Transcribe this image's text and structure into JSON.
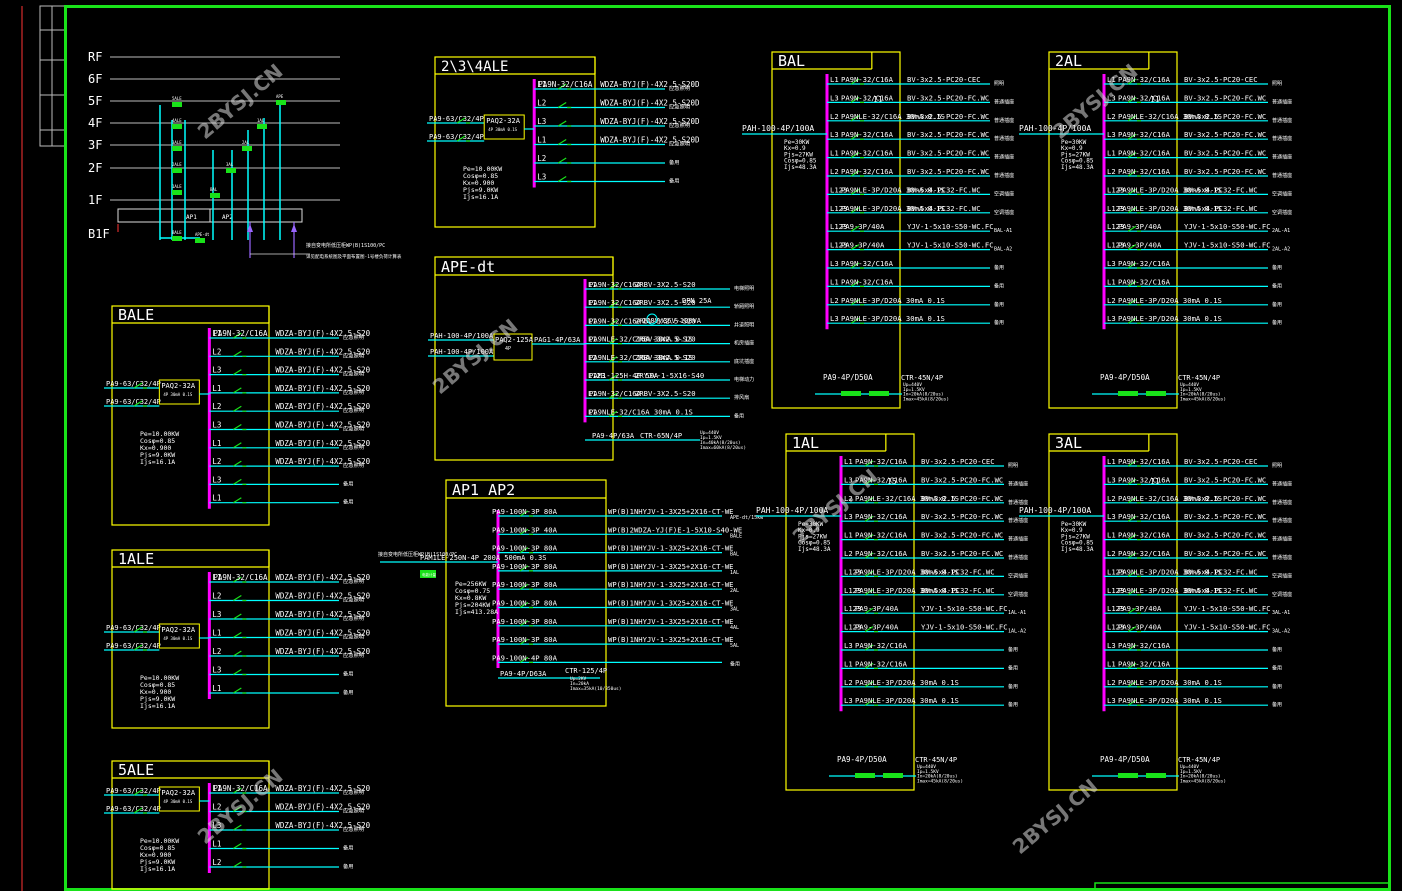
{
  "colors": {
    "frame": "#19e219",
    "panel": "#ffff00",
    "bus": "#ff00ff",
    "feeder": "#00ffff",
    "switch": "#19e219",
    "text": "#ffffff",
    "label": "#ffff66",
    "ext": "#ff3333"
  },
  "riser": {
    "floors": [
      "RF",
      "6F",
      "5F",
      "4F",
      "3F",
      "2F",
      "1F",
      "B1F"
    ],
    "box1": "AP1",
    "box2": "AP2",
    "note1": "接自变电所低压柜WP(B)1S100/PC",
    "note2": "详见配电系统图及平面布置图-1号楼负荷计算表",
    "tags": [
      "5ALE",
      "4ALE",
      "3ALE",
      "2ALE",
      "1ALE",
      "BALE",
      "3AL",
      "2AL",
      "1AL",
      "APE",
      "BAL",
      "APE-dt"
    ]
  },
  "watermarks": [
    "2BYSJ.CN",
    "2BYSJ.CN",
    "2BYSJ.CN",
    "2BYSJ.CN",
    "2BYSJ.CN",
    "2BYSJ.CN"
  ],
  "panels": {
    "ale234": {
      "title": "2\\3\\4ALE",
      "in1": "PA9-63/C32/4P",
      "in2": "PA9-63/C32/4P",
      "spd": "PAQ2-32A",
      "spd_sub": "4P 30mA 0.1S",
      "calc": [
        "Pe=10.00KW",
        "Cosφ=0.85",
        "Kx=0.900",
        "Pjs=9.0KW",
        "Ijs=16.1A"
      ],
      "rows": [
        {
          "ph": "L1",
          "cb": "PA9N-32/C16A",
          "cable": "WDZA-BYJ(F)-4X2.5-S20D",
          "use": "应急照明"
        },
        {
          "ph": "L2",
          "cb": "",
          "cable": "WDZA-BYJ(F)-4X2.5-S20D",
          "use": "应急照明"
        },
        {
          "ph": "L3",
          "cb": "",
          "cable": "WDZA-BYJ(F)-4X2.5-S20D",
          "use": "应急照明"
        },
        {
          "ph": "L1",
          "cb": "",
          "cable": "WDZA-BYJ(F)-4X2.5-S20D",
          "use": "应急照明"
        },
        {
          "ph": "L2",
          "cb": "",
          "cable": "",
          "use": "备用"
        },
        {
          "ph": "L3",
          "cb": "",
          "cable": "",
          "use": "备用"
        }
      ]
    },
    "bale": {
      "title": "BALE",
      "in1": "PA9-63/C32/4P",
      "in2": "PA9-63/C32/4P",
      "spd": "PAQ2-32A",
      "spd_sub": "4P 30mA 0.1S",
      "calc": [
        "Pe=10.00KW",
        "Cosφ=0.85",
        "Kx=0.900",
        "Pjs=9.0KW",
        "Ijs=16.1A"
      ],
      "rows": [
        {
          "ph": "L1",
          "cb": "PA9N-32/C16A",
          "cable": "WDZA-BYJ(F)-4X2.5-S20",
          "use": "应急照明"
        },
        {
          "ph": "L2",
          "cb": "",
          "cable": "WDZA-BYJ(F)-4X2.5-S20",
          "use": "应急照明"
        },
        {
          "ph": "L3",
          "cb": "",
          "cable": "WDZA-BYJ(F)-4X2.5-S20",
          "use": "应急照明"
        },
        {
          "ph": "L1",
          "cb": "",
          "cable": "WDZA-BYJ(F)-4X2.5-S20",
          "use": "应急照明"
        },
        {
          "ph": "L2",
          "cb": "",
          "cable": "WDZA-BYJ(F)-4X2.5-S20",
          "use": "应急照明"
        },
        {
          "ph": "L3",
          "cb": "",
          "cable": "WDZA-BYJ(F)-4X2.5-S20",
          "use": "应急照明"
        },
        {
          "ph": "L1",
          "cb": "",
          "cable": "WDZA-BYJ(F)-4X2.5-S20",
          "use": "应急照明"
        },
        {
          "ph": "L2",
          "cb": "",
          "cable": "WDZA-BYJ(F)-4X2.5-S20",
          "use": "应急照明"
        },
        {
          "ph": "L3",
          "cb": "",
          "cable": "",
          "use": "备用"
        },
        {
          "ph": "L1",
          "cb": "",
          "cable": "",
          "use": "备用"
        }
      ]
    },
    "ale1": {
      "title": "1ALE",
      "in1": "PA9-63/C32/4P",
      "in2": "PA9-63/C32/4P",
      "spd": "PAQ2-32A",
      "spd_sub": "4P 30mA 0.1S",
      "calc": [
        "Pe=10.00KW",
        "Cosφ=0.85",
        "Kx=0.900",
        "Pjs=9.0KW",
        "Ijs=16.1A"
      ],
      "rows": [
        {
          "ph": "L1",
          "cb": "PA9N-32/C16A",
          "cable": "WDZA-BYJ(F)-4X2.5-S20",
          "use": "应急照明"
        },
        {
          "ph": "L2",
          "cb": "",
          "cable": "WDZA-BYJ(F)-4X2.5-S20",
          "use": "应急照明"
        },
        {
          "ph": "L3",
          "cb": "",
          "cable": "WDZA-BYJ(F)-4X2.5-S20",
          "use": "应急照明"
        },
        {
          "ph": "L1",
          "cb": "",
          "cable": "WDZA-BYJ(F)-4X2.5-S20",
          "use": "应急照明"
        },
        {
          "ph": "L2",
          "cb": "",
          "cable": "WDZA-BYJ(F)-4X2.5-S20",
          "use": "应急照明"
        },
        {
          "ph": "L3",
          "cb": "",
          "cable": "",
          "use": "备用"
        },
        {
          "ph": "L1",
          "cb": "",
          "cable": "",
          "use": "备用"
        }
      ]
    },
    "ale5": {
      "title": "5ALE",
      "in1": "PA9-63/C32/4P",
      "in2": "PA9-63/C32/4P",
      "spd": "PAQ2-32A",
      "spd_sub": "4P 30mA 0.1S",
      "calc": [
        "Pe=10.00KW",
        "Cosφ=0.85",
        "Kx=0.900",
        "Pjs=9.0KW",
        "Ijs=16.1A"
      ],
      "rows": [
        {
          "ph": "L1",
          "cb": "PA9N-32/C16A",
          "cable": "WDZA-BYJ(F)-4X2.5-S20",
          "use": "应急照明"
        },
        {
          "ph": "L2",
          "cb": "",
          "cable": "WDZA-BYJ(F)-4X2.5-S20",
          "use": "应急照明"
        },
        {
          "ph": "L3",
          "cb": "",
          "cable": "WDZA-BYJ(F)-4X2.5-S20",
          "use": "应急照明"
        },
        {
          "ph": "L1",
          "cb": "",
          "cable": "",
          "use": "备用"
        },
        {
          "ph": "L2",
          "cb": "",
          "cable": "",
          "use": "备用"
        }
      ]
    },
    "apedt": {
      "title": "APE-dt",
      "in1": "PAH-100-4P/100A",
      "in2": "PAH-100-4P/100A",
      "ats": "PAQ2-125A",
      "ats_sub": "4P",
      "main": "PAG1-4P/63A",
      "rows": [
        {
          "ph": "L1",
          "cb": "PA9N-32/C16A",
          "cable": "ZRBV-3X2.5-S20",
          "use": "电梯照明"
        },
        {
          "ph": "L1",
          "cb": "PA9N-32/C16A",
          "cable": "ZRBV-3X2.5-S20",
          "use": "轿厢照明"
        },
        {
          "ph": "L1",
          "cb": "PA9N-32/C16A",
          "cable": "ZRBV-3X2.5-S20",
          "use": "井道照明"
        },
        {
          "ph": "L1",
          "cb": "PA9NLE-32/C16A 30mA 0.1S",
          "cable": "ZRBV-3X2.5-S20",
          "use": "机房插座"
        },
        {
          "ph": "L2",
          "cb": "PA9NLE-32/C16A 30mA 0.1S",
          "cable": "ZRBV-3X2.5-S20",
          "use": "底坑插座"
        },
        {
          "ph": "L123",
          "cb": "PAM1-125H-4P 50A",
          "cable": "ZRYJV-1-5X16-S40",
          "use": "电梯动力"
        },
        {
          "ph": "L1",
          "cb": "PA9N-32/C16A",
          "cable": "ZRBV-3X2.5-S20",
          "use": "排风扇"
        },
        {
          "ph": "L1",
          "cb": "PA9NLE-32/C16A 30mA 0.1S",
          "cable": "",
          "use": "备用"
        }
      ],
      "extra": [
        "DPN 25A",
        "220V/36V-100VA"
      ],
      "spd": "PA9-4P/63A",
      "ctr": "CTR-65N/4P",
      "ctr_sub": [
        "Up=440V",
        "Ip=1.5KV",
        "In=40kA(8/20us)",
        "Imax=60kA(8/20us)"
      ]
    },
    "ap12": {
      "title": "AP1 AP2",
      "in_note": "接自变电所低压柜WP(B)1S100/PC",
      "in_cb": "PAM1LE-250N-4P 200A 500mA 0.3S",
      "meter": "电能计量",
      "calc": [
        "Pe=256KW",
        "Cosφ=0.75",
        "Kx=0.8KW",
        "Pjs=204KW",
        "Ijs=413.28A"
      ],
      "rows": [
        {
          "cb": "PA9-100N-3P 80A",
          "cable": "WP(B)1NHYJV-1-3X25+2X16-CT-WE",
          "to": "APE-dt/15kw"
        },
        {
          "cb": "PA9-100N-3P 40A",
          "cable": "WP(B)2WDZA-YJ(F)E-1-5X10-S40-WE",
          "to": "BALE"
        },
        {
          "cb": "PA9-100N-3P 80A",
          "cable": "WP(B)1NHYJV-1-3X25+2X16-CT-WE",
          "to": "BAL"
        },
        {
          "cb": "PA9-100N-3P 80A",
          "cable": "WP(B)1NHYJV-1-3X25+2X16-CT-WE",
          "to": "1AL"
        },
        {
          "cb": "PA9-100N-3P 80A",
          "cable": "WP(B)1NHYJV-1-3X25+2X16-CT-WE",
          "to": "2AL"
        },
        {
          "cb": "PA9-100N-3P 80A",
          "cable": "WP(B)1NHYJV-1-3X25+2X16-CT-WE",
          "to": "3AL"
        },
        {
          "cb": "PA9-100N-3P 80A",
          "cable": "WP(B)1NHYJV-1-3X25+2X16-CT-WE",
          "to": "4AL"
        },
        {
          "cb": "PA9-100N-3P 80A",
          "cable": "WP(B)1NHYJV-1-3X25+2X16-CT-WE",
          "to": "5AL"
        },
        {
          "cb": "PA9-100N-4P 80A",
          "cable": "",
          "to": "备用"
        }
      ],
      "spd": "PA9-4P/D63A",
      "ctr": "CTR-125/4P",
      "ctr_sub": [
        "Up=2KV",
        "In=20kA",
        "Imax=35kA(10/350us)"
      ]
    },
    "bal": {
      "title": "BAL",
      "in1": "PAH-100-4P/100A",
      "calc": [
        "Pe=30KW",
        "Kx=0.9",
        "Pjs=27KW",
        "Cosφ=0.85",
        "Ijs=48.3A"
      ],
      "mark": "11",
      "rows": [
        {
          "ph": "L1",
          "cb": "PA9N-32/C16A",
          "cable": "BV-3x2.5-PC20-CEC",
          "use": "照明"
        },
        {
          "ph": "L3",
          "cb": "PA9N-32/C16A",
          "cable": "BV-3x2.5-PC20-FC.WC",
          "use": "普通插座"
        },
        {
          "ph": "L2",
          "cb": "PA9NLE-32/C16A 30mA 0.1S",
          "cable": "BV-3x2.5-PC20-FC.WC",
          "use": "普通插座"
        },
        {
          "ph": "L3",
          "cb": "PA9N-32/C16A",
          "cable": "BV-3x2.5-PC20-FC.WC",
          "use": "普通插座"
        },
        {
          "ph": "L1",
          "cb": "PA9N-32/C16A",
          "cable": "BV-3x2.5-PC20-FC.WC",
          "use": "普通插座"
        },
        {
          "ph": "L2",
          "cb": "PA9N-32/C16A",
          "cable": "BV-3x2.5-PC20-FC.WC",
          "use": "普通插座"
        },
        {
          "ph": "L123",
          "cb": "PA9NLE-3P/D20A 30mA 0.1S",
          "cable": "BV-5x4-PC32-FC.WC",
          "use": "空调插座"
        },
        {
          "ph": "L123",
          "cb": "PA9NLE-3P/D20A 30mA 0.1S",
          "cable": "BV-5x4-PC32-FC.WC",
          "use": "空调插座"
        },
        {
          "ph": "L123",
          "cb": "PA9-3P/40A",
          "cable": "YJV-1-5x10-S50-WC.FC",
          "use": "BAL-A1"
        },
        {
          "ph": "L123",
          "cb": "PA9-3P/40A",
          "cable": "YJV-1-5x10-S50-WC.FC",
          "use": "BAL-A2"
        },
        {
          "ph": "L3",
          "cb": "PA9N-32/C16A",
          "cable": "",
          "use": "备用"
        },
        {
          "ph": "L1",
          "cb": "PA9N-32/C16A",
          "cable": "",
          "use": "备用"
        },
        {
          "ph": "L2",
          "cb": "PA9NLE-3P/D20A 30mA 0.1S",
          "cable": "",
          "use": "备用"
        },
        {
          "ph": "L3",
          "cb": "PA9NLE-3P/D20A 30mA 0.1S",
          "cable": "",
          "use": "备用"
        }
      ],
      "spd": "PA9-4P/D50A",
      "ctr": "CTR-45N/4P",
      "ctr_sub": [
        "Up=440V",
        "Ip=1.5KV",
        "In=20kA(8/20us)",
        "Imax=45kA(8/20us)"
      ]
    },
    "al2": {
      "title": "2AL",
      "in1": "PAH-100-4P/100A",
      "calc": [
        "Pe=30KW",
        "Kx=0.9",
        "Pjs=27KW",
        "Cosφ=0.85",
        "Ijs=48.3A"
      ],
      "mark": "11",
      "rows": [
        {
          "ph": "L1",
          "cb": "PA9N-32/C16A",
          "cable": "BV-3x2.5-PC20-CEC",
          "use": "照明"
        },
        {
          "ph": "L3",
          "cb": "PA9N-32/C16A",
          "cable": "BV-3x2.5-PC20-FC.WC",
          "use": "普通插座"
        },
        {
          "ph": "L2",
          "cb": "PA9NLE-32/C16A 30mA 0.1S",
          "cable": "BV-3x2.5-PC20-FC.WC",
          "use": "普通插座"
        },
        {
          "ph": "L3",
          "cb": "PA9N-32/C16A",
          "cable": "BV-3x2.5-PC20-FC.WC",
          "use": "普通插座"
        },
        {
          "ph": "L1",
          "cb": "PA9N-32/C16A",
          "cable": "BV-3x2.5-PC20-FC.WC",
          "use": "普通插座"
        },
        {
          "ph": "L2",
          "cb": "PA9N-32/C16A",
          "cable": "BV-3x2.5-PC20-FC.WC",
          "use": "普通插座"
        },
        {
          "ph": "L123",
          "cb": "PA9NLE-3P/D20A 30mA 0.1S",
          "cable": "BV-5x4-PC32-FC.WC",
          "use": "空调插座"
        },
        {
          "ph": "L123",
          "cb": "PA9NLE-3P/D20A 30mA 0.1S",
          "cable": "BV-5x4-PC32-FC.WC",
          "use": "空调插座"
        },
        {
          "ph": "L123",
          "cb": "PA9-3P/40A",
          "cable": "YJV-1-5x10-S50-WC.FC",
          "use": "2AL-A1"
        },
        {
          "ph": "L123",
          "cb": "PA9-3P/40A",
          "cable": "YJV-1-5x10-S50-WC.FC",
          "use": "2AL-A2"
        },
        {
          "ph": "L3",
          "cb": "PA9N-32/C16A",
          "cable": "",
          "use": "备用"
        },
        {
          "ph": "L1",
          "cb": "PA9N-32/C16A",
          "cable": "",
          "use": "备用"
        },
        {
          "ph": "L2",
          "cb": "PA9NLE-3P/D20A 30mA 0.1S",
          "cable": "",
          "use": "备用"
        },
        {
          "ph": "L3",
          "cb": "PA9NLE-3P/D20A 30mA 0.1S",
          "cable": "",
          "use": "备用"
        }
      ],
      "spd": "PA9-4P/D50A",
      "ctr": "CTR-45N/4P",
      "ctr_sub": [
        "Up=440V",
        "Ip=1.5KV",
        "In=20kA(8/20us)",
        "Imax=45kA(8/20us)"
      ]
    },
    "al1": {
      "title": "1AL",
      "in1": "PAH-100-4P/100A",
      "calc": [
        "Pe=30KW",
        "Kx=0.9",
        "Pjs=27KW",
        "Cosφ=0.85",
        "Ijs=48.3A"
      ],
      "mark": "15",
      "rows": [
        {
          "ph": "L1",
          "cb": "PA9N-32/C16A",
          "cable": "BV-3x2.5-PC20-CEC",
          "use": "照明"
        },
        {
          "ph": "L3",
          "cb": "PA9N-32/C16A",
          "cable": "BV-3x2.5-PC20-FC.WC",
          "use": "普通插座"
        },
        {
          "ph": "L2",
          "cb": "PA9NLE-32/C16A 30mA 0.1S",
          "cable": "BV-3x2.5-PC20-FC.WC",
          "use": "普通插座"
        },
        {
          "ph": "L3",
          "cb": "PA9N-32/C16A",
          "cable": "BV-3x2.5-PC20-FC.WC",
          "use": "普通插座"
        },
        {
          "ph": "L1",
          "cb": "PA9N-32/C16A",
          "cable": "BV-3x2.5-PC20-FC.WC",
          "use": "普通插座"
        },
        {
          "ph": "L2",
          "cb": "PA9N-32/C16A",
          "cable": "BV-3x2.5-PC20-FC.WC",
          "use": "普通插座"
        },
        {
          "ph": "L123",
          "cb": "PA9NLE-3P/D20A 30mA 0.1S",
          "cable": "BV-5x4-PC32-FC.WC",
          "use": "空调插座"
        },
        {
          "ph": "L123",
          "cb": "PA9NLE-3P/D20A 30mA 0.1S",
          "cable": "BV-5x4-PC32-FC.WC",
          "use": "空调插座"
        },
        {
          "ph": "L123",
          "cb": "PA9-3P/40A",
          "cable": "YJV-1-5x10-S50-WC.FC",
          "use": "1AL-A1"
        },
        {
          "ph": "L123",
          "cb": "PA9-3P/40A",
          "cable": "YJV-1-5x10-S50-WC.FC",
          "use": "1AL-A2"
        },
        {
          "ph": "L3",
          "cb": "PA9N-32/C16A",
          "cable": "",
          "use": "备用"
        },
        {
          "ph": "L1",
          "cb": "PA9N-32/C16A",
          "cable": "",
          "use": "备用"
        },
        {
          "ph": "L2",
          "cb": "PA9NLE-3P/D20A 30mA 0.1S",
          "cable": "",
          "use": "备用"
        },
        {
          "ph": "L3",
          "cb": "PA9NLE-3P/D20A 30mA 0.1S",
          "cable": "",
          "use": "备用"
        }
      ],
      "spd": "PA9-4P/D50A",
      "ctr": "CTR-45N/4P",
      "ctr_sub": [
        "Up=440V",
        "Ip=1.5KV",
        "In=20kA(8/20us)",
        "Imax=45kA(8/20us)"
      ]
    },
    "al3": {
      "title": "3AL",
      "in1": "PAH-100-4P/100A",
      "calc": [
        "Pe=30KW",
        "Kx=0.9",
        "Pjs=27KW",
        "Cosφ=0.85",
        "Ijs=48.3A"
      ],
      "mark": "11",
      "rows": [
        {
          "ph": "L1",
          "cb": "PA9N-32/C16A",
          "cable": "BV-3x2.5-PC20-CEC",
          "use": "照明"
        },
        {
          "ph": "L3",
          "cb": "PA9N-32/C16A",
          "cable": "BV-3x2.5-PC20-FC.WC",
          "use": "普通插座"
        },
        {
          "ph": "L2",
          "cb": "PA9NLE-32/C16A 30mA 0.1S",
          "cable": "BV-3x2.5-PC20-FC.WC",
          "use": "普通插座"
        },
        {
          "ph": "L3",
          "cb": "PA9N-32/C16A",
          "cable": "BV-3x2.5-PC20-FC.WC",
          "use": "普通插座"
        },
        {
          "ph": "L1",
          "cb": "PA9N-32/C16A",
          "cable": "BV-3x2.5-PC20-FC.WC",
          "use": "普通插座"
        },
        {
          "ph": "L2",
          "cb": "PA9N-32/C16A",
          "cable": "BV-3x2.5-PC20-FC.WC",
          "use": "普通插座"
        },
        {
          "ph": "L123",
          "cb": "PA9NLE-3P/D20A 30mA 0.1S",
          "cable": "BV-5x4-PC32-FC.WC",
          "use": "空调插座"
        },
        {
          "ph": "L123",
          "cb": "PA9NLE-3P/D20A 30mA 0.1S",
          "cable": "BV-5x4-PC32-FC.WC",
          "use": "空调插座"
        },
        {
          "ph": "L123",
          "cb": "PA9-3P/40A",
          "cable": "YJV-1-5x10-S50-WC.FC",
          "use": "3AL-A1"
        },
        {
          "ph": "L123",
          "cb": "PA9-3P/40A",
          "cable": "YJV-1-5x10-S50-WC.FC",
          "use": "3AL-A2"
        },
        {
          "ph": "L3",
          "cb": "PA9N-32/C16A",
          "cable": "",
          "use": "备用"
        },
        {
          "ph": "L1",
          "cb": "PA9N-32/C16A",
          "cable": "",
          "use": "备用"
        },
        {
          "ph": "L2",
          "cb": "PA9NLE-3P/D20A 30mA 0.1S",
          "cable": "",
          "use": "备用"
        },
        {
          "ph": "L3",
          "cb": "PA9NLE-3P/D20A 30mA 0.1S",
          "cable": "",
          "use": "备用"
        }
      ],
      "spd": "PA9-4P/D50A",
      "ctr": "CTR-45N/4P",
      "ctr_sub": [
        "Up=440V",
        "Ip=1.5KV",
        "In=20kA(8/20us)",
        "Imax=45kA(8/20us)"
      ]
    }
  }
}
